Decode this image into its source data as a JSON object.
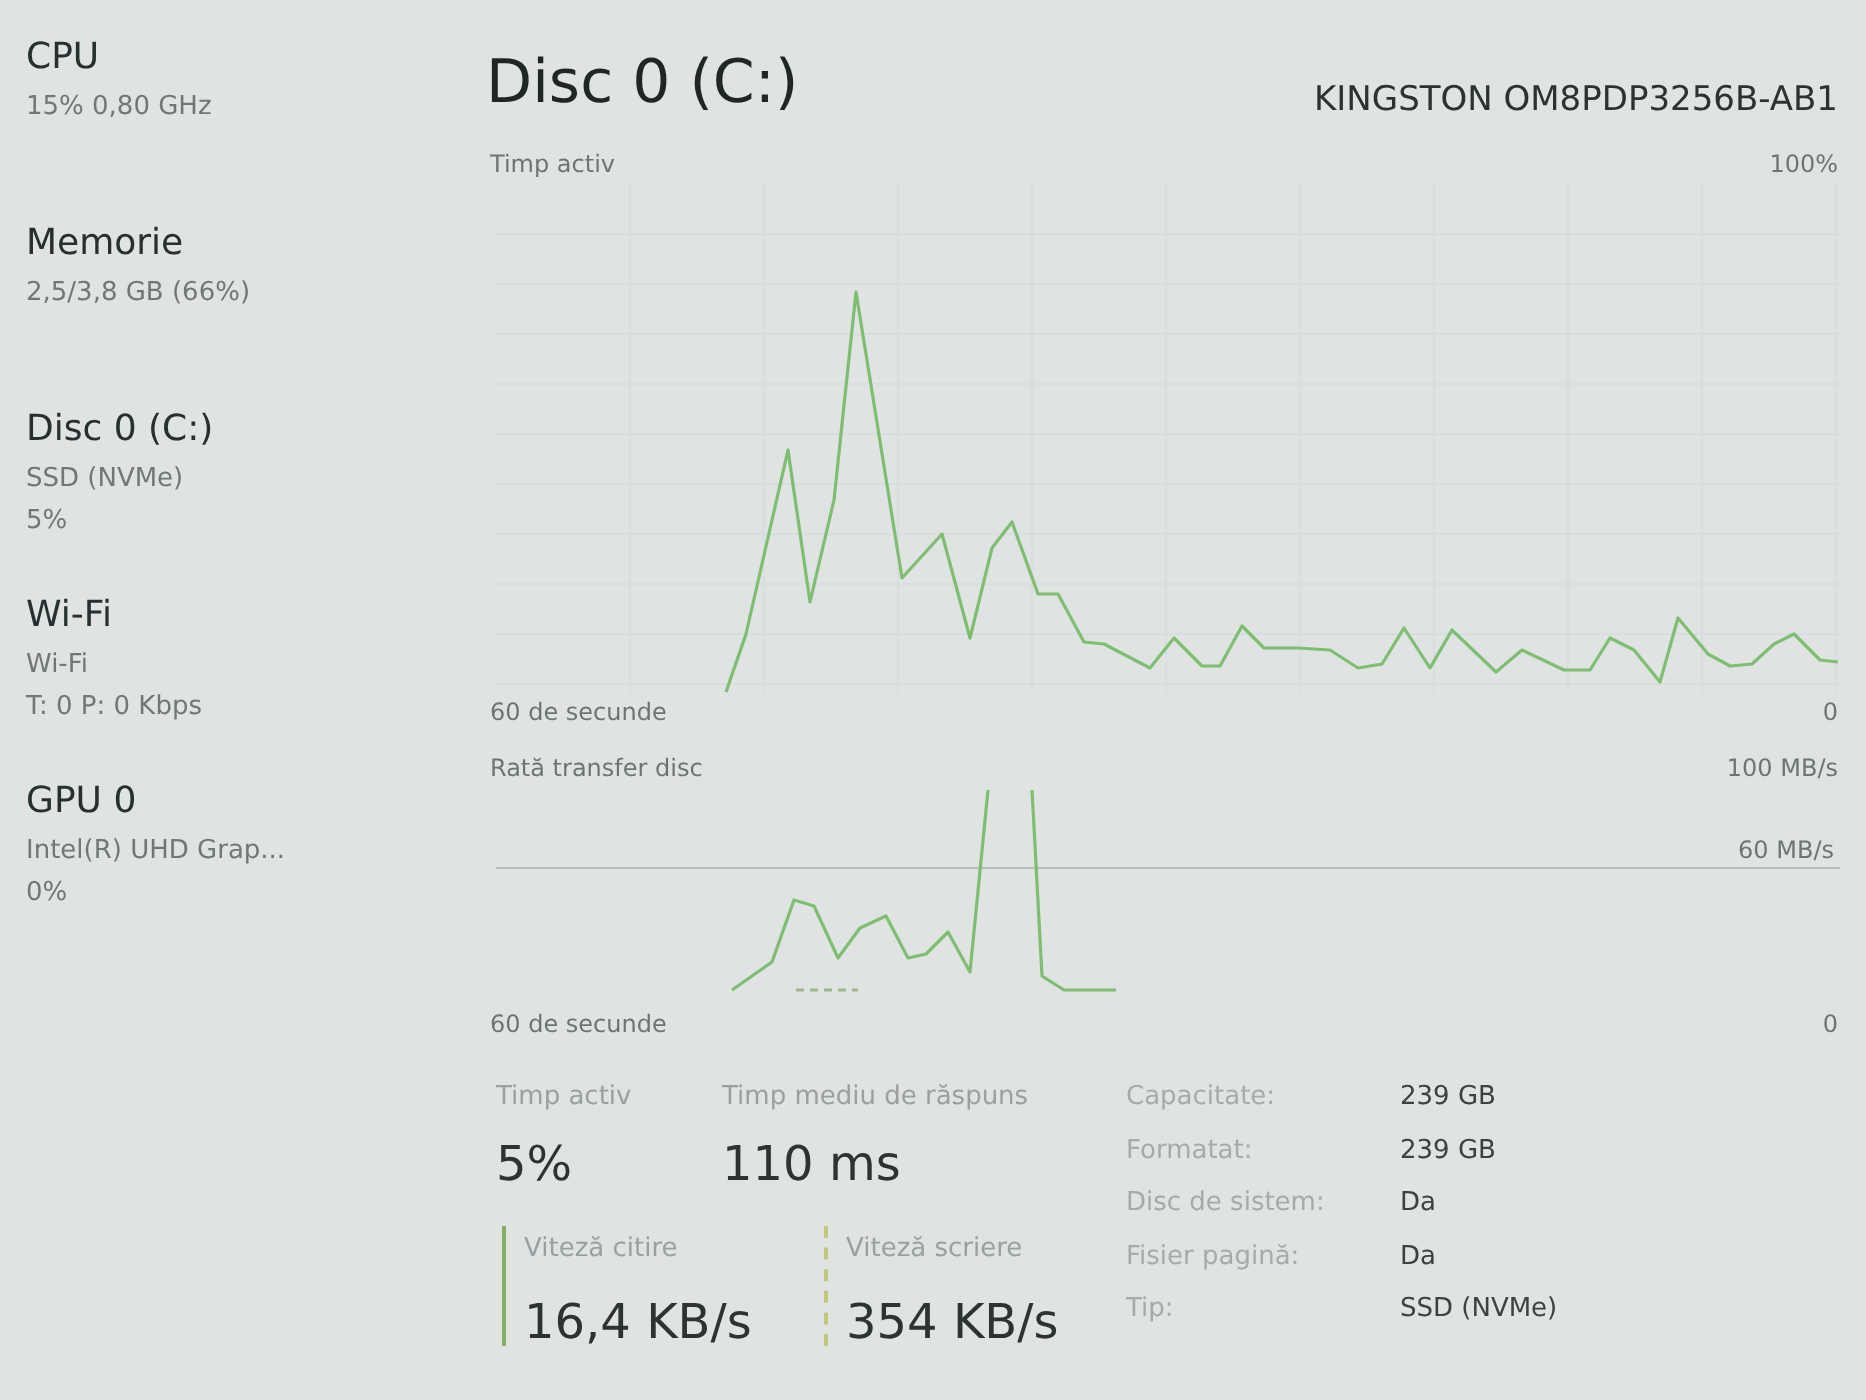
{
  "sidebar": {
    "items": [
      {
        "title": "CPU",
        "details": [
          "15% 0,80 GHz"
        ]
      },
      {
        "title": "Memorie",
        "details": [
          "2,5/3,8 GB (66%)"
        ]
      },
      {
        "title": "Disc 0 (C:)",
        "details": [
          "SSD (NVMe)",
          "5%"
        ]
      },
      {
        "title": "Wi-Fi",
        "details": [
          "Wi-Fi",
          "T: 0 P: 0 Kbps"
        ]
      },
      {
        "title": "GPU 0",
        "details": [
          "Intel(R) UHD Grap...",
          "0%"
        ]
      }
    ]
  },
  "header": {
    "title": "Disc 0 (C:)",
    "model": "KINGSTON OM8PDP3256B-AB1"
  },
  "active_time_graph": {
    "label": "Timp activ",
    "max_label": "100%",
    "start_label": "60 de secunde",
    "end_label": "0"
  },
  "transfer_graph": {
    "label": "Rată transfer disc",
    "max_label": "100 MB/s",
    "line_label": "60 MB/s",
    "start_label": "60 de secunde",
    "end_label": "0"
  },
  "stats": [
    {
      "label": "Timp activ",
      "value": "5%"
    },
    {
      "label": "Timp mediu de răspuns",
      "value": "110 ms"
    }
  ],
  "speeds": [
    {
      "kind": "read",
      "label": "Viteză citire",
      "value": "16,4 KB/s"
    },
    {
      "kind": "write",
      "label": "Viteză scriere",
      "value": "354 KB/s"
    }
  ],
  "properties": [
    {
      "label": "Capacitate:",
      "value": "239 GB"
    },
    {
      "label": "Formatat:",
      "value": "239 GB"
    },
    {
      "label": "Disc de sistem:",
      "value": "Da"
    },
    {
      "label": "Fisier pagină:",
      "value": "Da"
    },
    {
      "label": "Tip:",
      "value": "SSD (NVMe)"
    }
  ]
}
